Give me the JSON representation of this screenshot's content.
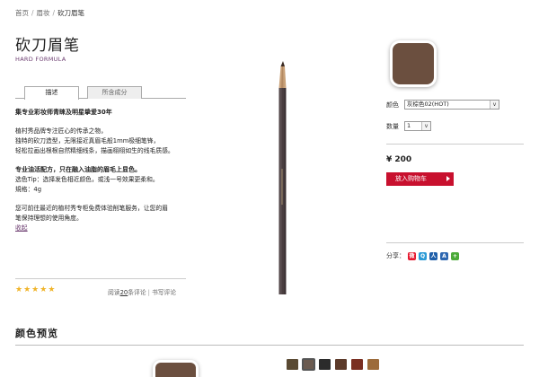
{
  "breadcrumb": {
    "items": [
      "首页",
      "眉妆",
      "砍刀眉笔"
    ],
    "separator": "/"
  },
  "product": {
    "title": "砍刀眉笔",
    "subtitle": "HARD FORMULA"
  },
  "tabs": [
    {
      "label": "描述"
    },
    {
      "label": "所含成分"
    }
  ],
  "description": {
    "headline": "集专业彩妆师青睐及明星挚爱30年",
    "para1": [
      "植村秀品牌专注匠心的传承之物，",
      "独特的砍刀造型，无限接近真眉毛般1mm极细笔锋，",
      "轻松拉画出根根自然精细线条，描画栩栩如生的线毛质感。"
    ],
    "highlight": "专业油活配方，只在融入油脂的眉毛上显色。",
    "tip": "选色Tip：选择发色相近颜色，或浅一号效果更柔和。",
    "spec": "規格：4g",
    "para2": [
      "您可前往最近的植村秀专柜免费体验削笔服务，让您的眉",
      "笔保持理想的使用角度。"
    ],
    "collapse": "收起"
  },
  "rating": {
    "stars": 5,
    "filled": 5
  },
  "reviews": {
    "prefix": "阅读",
    "count": "20",
    "suffix": "条评论",
    "write": "书写评论",
    "pipe": "|"
  },
  "options": {
    "color_label": "颜色",
    "color_value": "灰棕色02(HOT)",
    "qty_label": "数量",
    "qty_value": "1",
    "arrow": "v"
  },
  "price": "¥ 200",
  "cart_button": "放入购物车",
  "share": {
    "label": "分享：",
    "icons": [
      {
        "name": "weibo-icon",
        "glyph": "微",
        "color": "#e6162d"
      },
      {
        "name": "qzone-icon",
        "glyph": "Q",
        "color": "#2b9ad6"
      },
      {
        "name": "renren-icon",
        "glyph": "人",
        "color": "#1f5fa9"
      },
      {
        "name": "douban-icon",
        "glyph": "A",
        "color": "#2c66b0"
      },
      {
        "name": "more-share-icon",
        "glyph": "+",
        "color": "#4caa3a"
      }
    ]
  },
  "colors": {
    "main_swatch": "#6b4f3f",
    "accent": "#c8102e",
    "subtitle": "#6b3b6f",
    "mini_swatches": [
      "#5a4a33",
      "#6b5a4f",
      "#2b2b2b",
      "#5c3a2a",
      "#7a2f22",
      "#9c6b3a"
    ]
  },
  "preview": {
    "title": "颜色预览"
  }
}
